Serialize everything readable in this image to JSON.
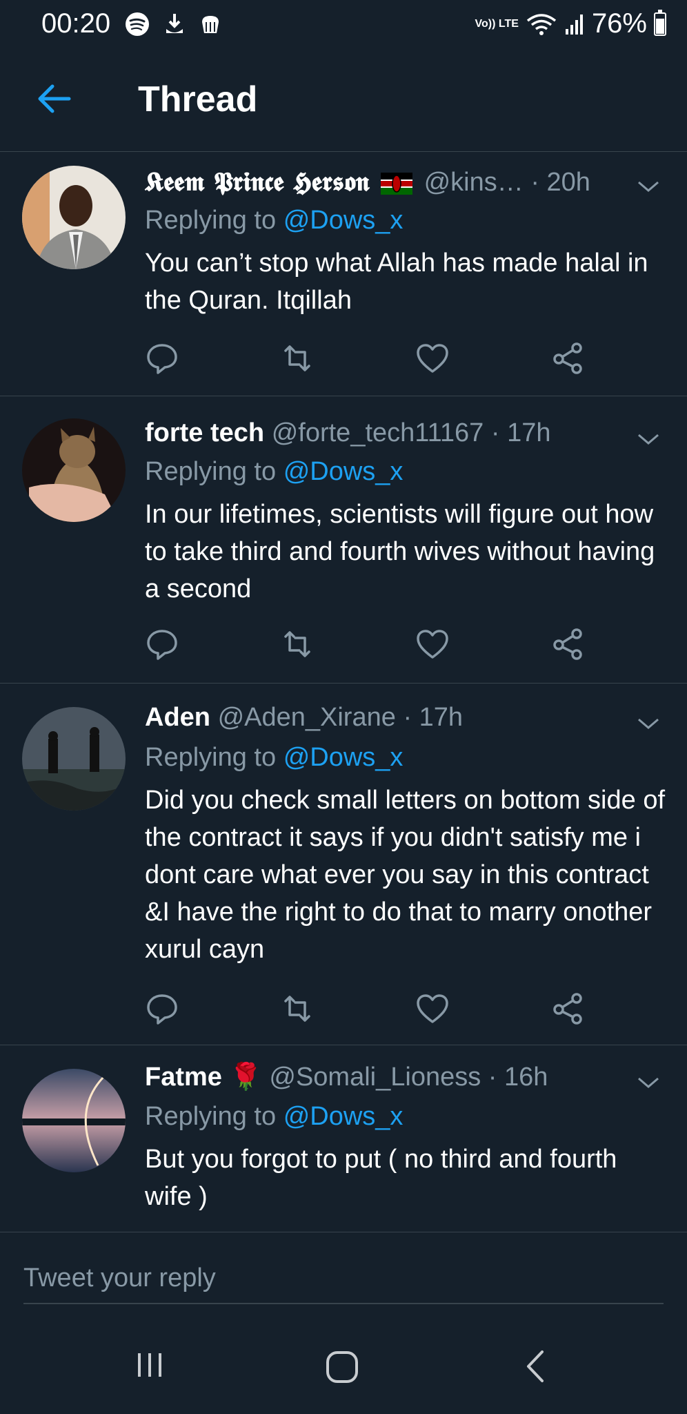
{
  "status_bar": {
    "time": "00:20",
    "network": "Vo)) LTE",
    "battery": "76%",
    "icons": [
      "spotify-icon",
      "download-icon",
      "cloud-icon",
      "wifi-icon",
      "signal-icon",
      "battery-icon"
    ]
  },
  "header": {
    "title": "Thread",
    "back_icon": "arrow-left-icon"
  },
  "tweets": [
    {
      "name": "𝕶𝖊𝖊𝖒 𝕻𝖗𝖎𝖓𝖈𝖊 𝕳𝖊𝖗𝖘𝖔𝖓",
      "flag": "kenya-flag-icon",
      "handle": "@kins…",
      "time": "· 20h",
      "replying_prefix": "Replying to",
      "replying_to": "@Dows_x",
      "text": "You can’t stop what Allah has made halal in the Quran. Itqillah"
    },
    {
      "name": "forte tech",
      "handle": "@forte_tech11167",
      "time": "· 17h",
      "replying_prefix": "Replying to",
      "replying_to": "@Dows_x",
      "text": "In our lifetimes, scientists will figure out how to take third and fourth wives without having a second"
    },
    {
      "name": "Aden",
      "handle": "@Aden_Xirane",
      "time": "· 17h",
      "replying_prefix": "Replying to",
      "replying_to": "@Dows_x",
      "text": "Did you check small letters on bottom side of the contract it says if you didn't satisfy me i dont care what ever you say in this contract &I have the right to do that to marry onother xurul cayn"
    },
    {
      "name": "Fatme",
      "emoji": "🌹",
      "handle": "@Somali_Lioness",
      "time": "· 16h",
      "replying_prefix": "Replying to",
      "replying_to": "@Dows_x",
      "text": "But you forgot to put ( no third and fourth wife )"
    }
  ],
  "reply": {
    "placeholder": "Tweet your reply"
  },
  "colors": {
    "background": "#15202b",
    "accent": "#1da1f2",
    "secondary_text": "#8899a6",
    "divider": "#38444d"
  }
}
